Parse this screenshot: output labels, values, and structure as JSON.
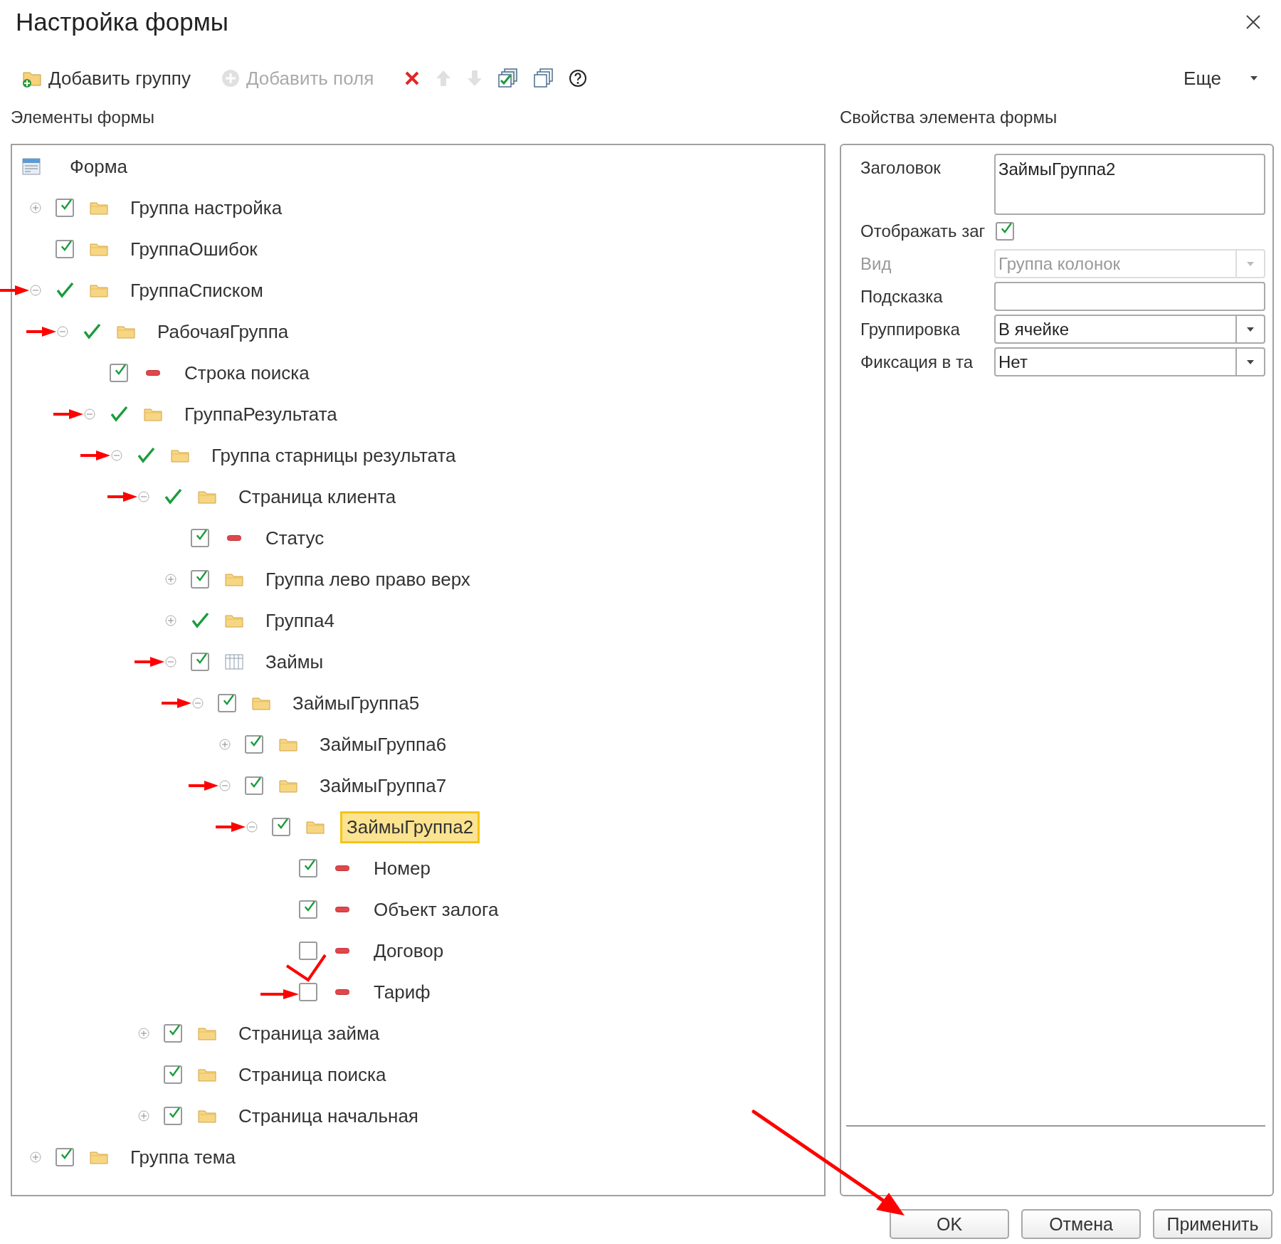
{
  "window": {
    "title": "Настройка формы"
  },
  "toolbar": {
    "items": [
      {
        "kind": "add_group",
        "label": "Добавить группу",
        "disabled": false
      },
      {
        "kind": "add_fields",
        "label": "Добавить поля",
        "disabled": true
      },
      {
        "kind": "delete",
        "disabled": false
      },
      {
        "kind": "up",
        "disabled": true
      },
      {
        "kind": "down",
        "disabled": true
      },
      {
        "kind": "check_all",
        "disabled": false
      },
      {
        "kind": "uncheck_all",
        "disabled": false
      },
      {
        "kind": "help",
        "disabled": false
      }
    ],
    "more": "Еще"
  },
  "elements_panel": {
    "title": "Элементы формы",
    "tree": {
      "label": "Форма",
      "kind": "form",
      "children": [
        {
          "label": "Группа настройка",
          "kind": "folder",
          "checked": true,
          "boxed": true,
          "expanded": false,
          "selected": false,
          "arrow": false,
          "red_check": false
        },
        {
          "label": "ГруппаОшибок",
          "kind": "folder",
          "checked": true,
          "boxed": true,
          "selected": false,
          "arrow": false,
          "red_check": false
        },
        {
          "label": "ГруппаСписком",
          "kind": "folder",
          "checked": true,
          "boxed": false,
          "expanded": true,
          "selected": false,
          "arrow": true,
          "red_check": false,
          "children": [
            {
              "label": "РабочаяГруппа",
              "kind": "folder",
              "checked": true,
              "boxed": false,
              "expanded": true,
              "selected": false,
              "arrow": true,
              "red_check": false,
              "children": [
                {
                  "label": "Строка поиска",
                  "kind": "field",
                  "checked": true,
                  "boxed": true,
                  "selected": false,
                  "arrow": false,
                  "red_check": false
                },
                {
                  "label": "ГруппаРезультата",
                  "kind": "folder",
                  "checked": true,
                  "boxed": false,
                  "expanded": true,
                  "selected": false,
                  "arrow": true,
                  "red_check": false,
                  "children": [
                    {
                      "label": "Группа старницы результата",
                      "kind": "folder",
                      "checked": true,
                      "boxed": false,
                      "expanded": true,
                      "selected": false,
                      "arrow": true,
                      "red_check": false,
                      "children": [
                        {
                          "label": "Страница клиента",
                          "kind": "folder",
                          "checked": true,
                          "boxed": false,
                          "expanded": true,
                          "selected": false,
                          "arrow": true,
                          "red_check": false,
                          "children": [
                            {
                              "label": "Статус",
                              "kind": "field",
                              "checked": true,
                              "boxed": true,
                              "selected": false,
                              "arrow": false,
                              "red_check": false
                            },
                            {
                              "label": "Группа лево право верх",
                              "kind": "folder",
                              "checked": true,
                              "boxed": true,
                              "expanded": false,
                              "selected": false,
                              "arrow": false,
                              "red_check": false
                            },
                            {
                              "label": "Группа4",
                              "kind": "folder",
                              "checked": true,
                              "boxed": false,
                              "expanded": false,
                              "selected": false,
                              "arrow": false,
                              "red_check": false
                            },
                            {
                              "label": "Займы",
                              "kind": "table",
                              "checked": true,
                              "boxed": true,
                              "expanded": true,
                              "selected": false,
                              "arrow": true,
                              "red_check": false,
                              "children": [
                                {
                                  "label": "ЗаймыГруппа5",
                                  "kind": "folder",
                                  "checked": true,
                                  "boxed": true,
                                  "expanded": true,
                                  "selected": false,
                                  "arrow": true,
                                  "red_check": false,
                                  "children": [
                                    {
                                      "label": "ЗаймыГруппа6",
                                      "kind": "folder",
                                      "checked": true,
                                      "boxed": true,
                                      "expanded": false,
                                      "selected": false,
                                      "arrow": false,
                                      "red_check": false
                                    },
                                    {
                                      "label": "ЗаймыГруппа7",
                                      "kind": "folder",
                                      "checked": true,
                                      "boxed": true,
                                      "expanded": true,
                                      "selected": false,
                                      "arrow": true,
                                      "red_check": false,
                                      "children": [
                                        {
                                          "label": "ЗаймыГруппа2",
                                          "kind": "folder",
                                          "checked": true,
                                          "boxed": true,
                                          "expanded": true,
                                          "selected": true,
                                          "arrow": true,
                                          "red_check": false,
                                          "children": [
                                            {
                                              "label": "Номер",
                                              "kind": "field",
                                              "checked": true,
                                              "boxed": true,
                                              "selected": false,
                                              "arrow": false,
                                              "red_check": false
                                            },
                                            {
                                              "label": "Объект залога",
                                              "kind": "field",
                                              "checked": true,
                                              "boxed": true,
                                              "selected": false,
                                              "arrow": false,
                                              "red_check": false
                                            },
                                            {
                                              "label": "Договор",
                                              "kind": "field",
                                              "checked": false,
                                              "boxed": true,
                                              "selected": false,
                                              "arrow": false,
                                              "red_check": false
                                            },
                                            {
                                              "label": "Тариф",
                                              "kind": "field",
                                              "checked": false,
                                              "boxed": true,
                                              "selected": false,
                                              "arrow": true,
                                              "red_check": true
                                            }
                                          ]
                                        }
                                      ]
                                    }
                                  ]
                                }
                              ]
                            }
                          ]
                        },
                        {
                          "label": "Страница займа",
                          "kind": "folder",
                          "checked": true,
                          "boxed": true,
                          "expanded": false,
                          "selected": false,
                          "arrow": false,
                          "red_check": false
                        },
                        {
                          "label": "Страница поиска",
                          "kind": "folder",
                          "checked": true,
                          "boxed": true,
                          "selected": false,
                          "arrow": false,
                          "red_check": false
                        },
                        {
                          "label": "Страница начальная",
                          "kind": "folder",
                          "checked": true,
                          "boxed": true,
                          "expanded": false,
                          "selected": false,
                          "arrow": false,
                          "red_check": false
                        }
                      ]
                    }
                  ]
                }
              ]
            }
          ]
        },
        {
          "label": "Группа тема",
          "kind": "folder",
          "checked": true,
          "boxed": true,
          "expanded": false,
          "selected": false,
          "arrow": false,
          "red_check": false
        }
      ]
    }
  },
  "properties_panel": {
    "title": "Свойства элемента формы",
    "fields": [
      {
        "kind": "textarea",
        "label": "Заголовок",
        "value": "ЗаймыГруппа2",
        "disabled": false
      },
      {
        "kind": "checkbox",
        "label": "Отображать заг",
        "checked": true,
        "disabled": false
      },
      {
        "kind": "select",
        "label": "Вид",
        "value": "Группа колонок",
        "disabled": true
      },
      {
        "kind": "text",
        "label": "Подсказка",
        "disabled": false
      },
      {
        "kind": "select",
        "label": "Группировка",
        "value": "В ячейке",
        "disabled": false
      },
      {
        "kind": "select",
        "label": "Фиксация в та",
        "value": "Нет",
        "disabled": false
      }
    ]
  },
  "buttons": [
    {
      "label": "OK",
      "arrow": true
    },
    {
      "label": "Отмена",
      "arrow": false
    },
    {
      "label": "Применить",
      "arrow": false
    }
  ]
}
